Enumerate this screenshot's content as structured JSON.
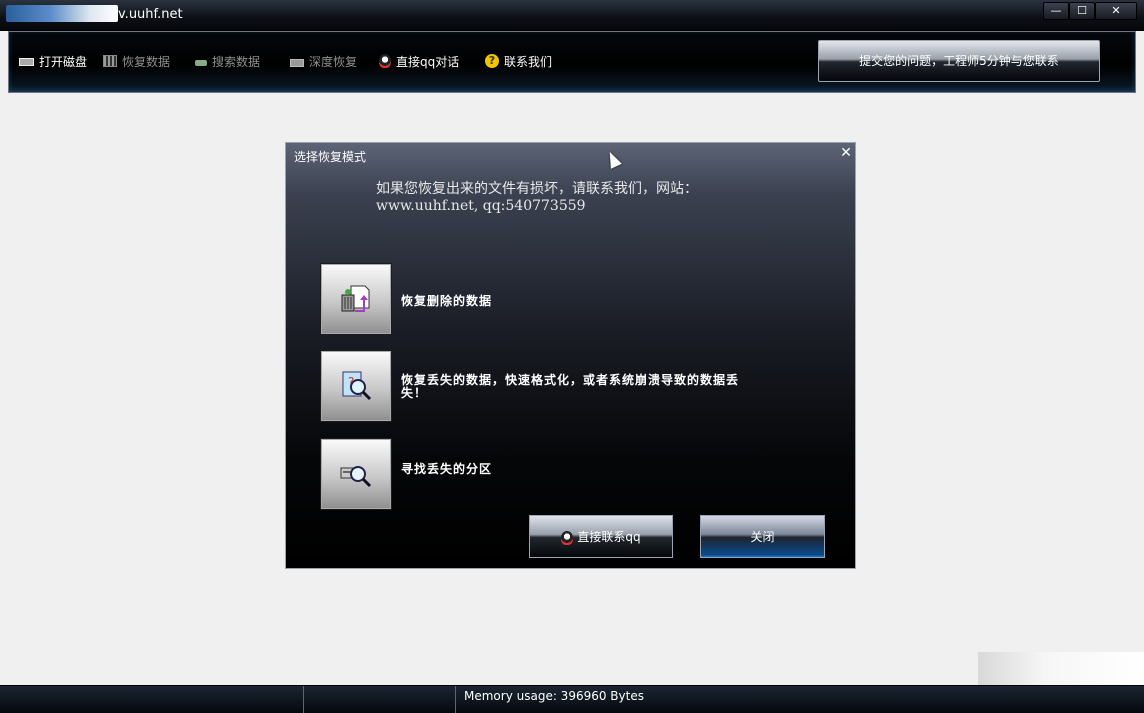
{
  "window": {
    "title": "v.uuhf.net",
    "min_glyph": "—",
    "max_glyph": "☐",
    "close_glyph": "✕"
  },
  "toolbar": {
    "items": [
      {
        "label": "打开磁盘",
        "icon": "disk-icon",
        "enabled": true
      },
      {
        "label": "恢复数据",
        "icon": "recover-icon",
        "enabled": false
      },
      {
        "label": "搜索数据",
        "icon": "search-icon",
        "enabled": false
      },
      {
        "label": "深度恢复",
        "icon": "deep-recover-icon",
        "enabled": false
      },
      {
        "label": "直接qq对话",
        "icon": "qq-icon",
        "enabled": true
      },
      {
        "label": "联系我们",
        "icon": "help-icon",
        "enabled": true
      }
    ],
    "submit_label": "提交您的问题，工程师5分钟与您联系",
    "help_glyph": "?"
  },
  "dialog": {
    "title": "选择恢复模式",
    "close_glyph": "✕",
    "info": "如果您恢复出来的文件有损坏，请联系我们，网站：www.uuhf.net, qq:540773559",
    "options": [
      {
        "label": "恢复删除的数据",
        "icon": "recycle-bin-icon"
      },
      {
        "label": "恢复丢失的数据，快速格式化，或者系统崩溃导致的数据丢失！",
        "icon": "document-search-icon"
      },
      {
        "label": "寻找丢失的分区",
        "icon": "drive-search-icon"
      }
    ],
    "qq_button": "直接联系qq",
    "close_button": "关闭"
  },
  "statusbar": {
    "memory": "Memory usage: 396960 Bytes"
  },
  "colors": {
    "accent_blue": "#1e7acc",
    "background": "#f0f0f0"
  }
}
